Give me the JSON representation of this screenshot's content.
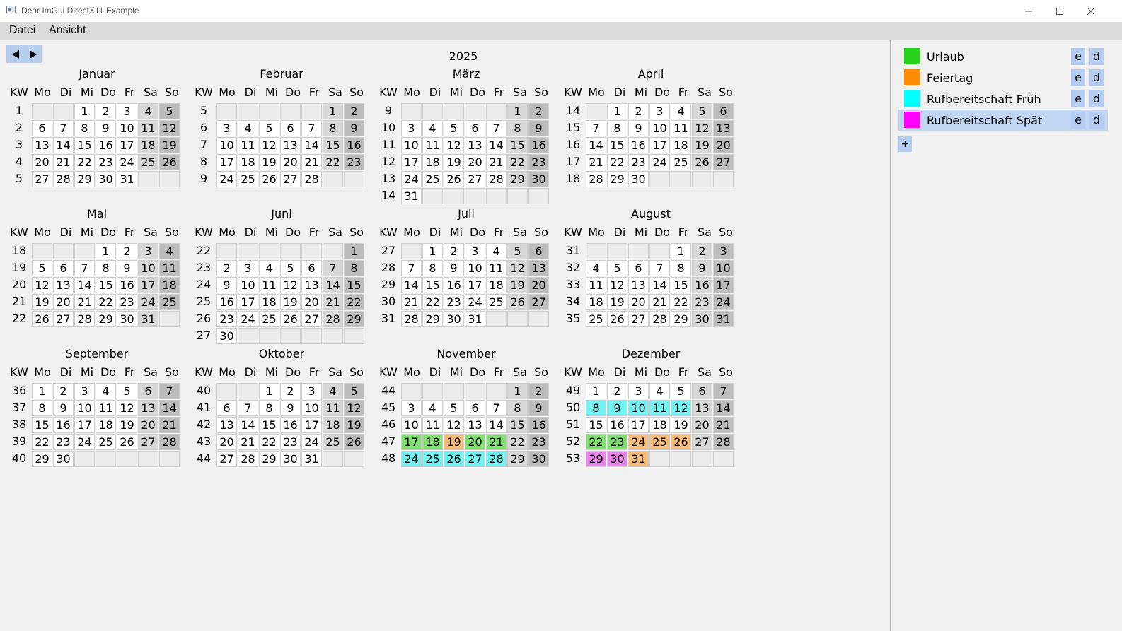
{
  "window": {
    "title": "Dear ImGui DirectX11 Example"
  },
  "menu": [
    "Datei",
    "Ansicht"
  ],
  "year": "2025",
  "weekday_headers": [
    "KW",
    "Mo",
    "Di",
    "Mi",
    "Do",
    "Fr",
    "Sa",
    "So"
  ],
  "colors": {
    "urlaub": "#26d21a",
    "feiertag": "#ff8c00",
    "rufbereitschaft_frueh": "#00ffff",
    "rufbereitschaft_spaet": "#ff00ff"
  },
  "months": [
    {
      "name": "Januar",
      "kw": [
        "1",
        "2",
        "3",
        "4",
        "5"
      ],
      "offset": 2,
      "days": 31
    },
    {
      "name": "Februar",
      "kw": [
        "5",
        "6",
        "7",
        "8",
        "9"
      ],
      "offset": 5,
      "days": 28
    },
    {
      "name": "März",
      "kw": [
        "9",
        "10",
        "11",
        "12",
        "13",
        "14"
      ],
      "offset": 5,
      "days": 31
    },
    {
      "name": "April",
      "kw": [
        "14",
        "15",
        "16",
        "17",
        "18"
      ],
      "offset": 1,
      "days": 30
    },
    {
      "name": "Mai",
      "kw": [
        "18",
        "19",
        "20",
        "21",
        "22"
      ],
      "offset": 3,
      "days": 31
    },
    {
      "name": "Juni",
      "kw": [
        "22",
        "23",
        "24",
        "25",
        "26",
        "27"
      ],
      "offset": 6,
      "days": 30
    },
    {
      "name": "Juli",
      "kw": [
        "27",
        "28",
        "29",
        "30",
        "31"
      ],
      "offset": 1,
      "days": 31
    },
    {
      "name": "August",
      "kw": [
        "31",
        "32",
        "33",
        "34",
        "35"
      ],
      "offset": 4,
      "days": 31
    },
    {
      "name": "September",
      "kw": [
        "36",
        "37",
        "38",
        "39",
        "40"
      ],
      "offset": 0,
      "days": 30
    },
    {
      "name": "Oktober",
      "kw": [
        "40",
        "41",
        "42",
        "43",
        "44"
      ],
      "offset": 2,
      "days": 31
    },
    {
      "name": "November",
      "kw": [
        "44",
        "45",
        "46",
        "47",
        "48"
      ],
      "offset": 5,
      "days": 30
    },
    {
      "name": "Dezember",
      "kw": [
        "49",
        "50",
        "51",
        "52",
        "53"
      ],
      "offset": 0,
      "days": 31
    }
  ],
  "marks": {
    "November": {
      "17": "urlaub",
      "18": "urlaub",
      "19": "feiertag",
      "20": "urlaub",
      "21": "urlaub",
      "24": "rfrueh",
      "25": "rfrueh",
      "26": "rfrueh",
      "27": "rfrueh",
      "28": "rfrueh"
    },
    "Dezember": {
      "8": "rfrueh",
      "9": "rfrueh",
      "10": "rfrueh",
      "11": "rfrueh",
      "12": "rfrueh",
      "22": "urlaub",
      "23": "urlaub",
      "24": "feiertag",
      "25": "feiertag",
      "26": "feiertag",
      "29": "rspaet",
      "30": "rspaet",
      "31": "feiertag"
    }
  },
  "legend": [
    {
      "label": "Urlaub",
      "color": "#26d21a",
      "selected": false
    },
    {
      "label": "Feiertag",
      "color": "#ff8c00",
      "selected": false
    },
    {
      "label": "Rufbereitschaft Früh",
      "color": "#00ffff",
      "selected": false
    },
    {
      "label": "Rufbereitschaft Spät",
      "color": "#ff00ff",
      "selected": true
    }
  ],
  "legend_buttons": {
    "edit": "e",
    "delete": "d",
    "add": "+"
  }
}
